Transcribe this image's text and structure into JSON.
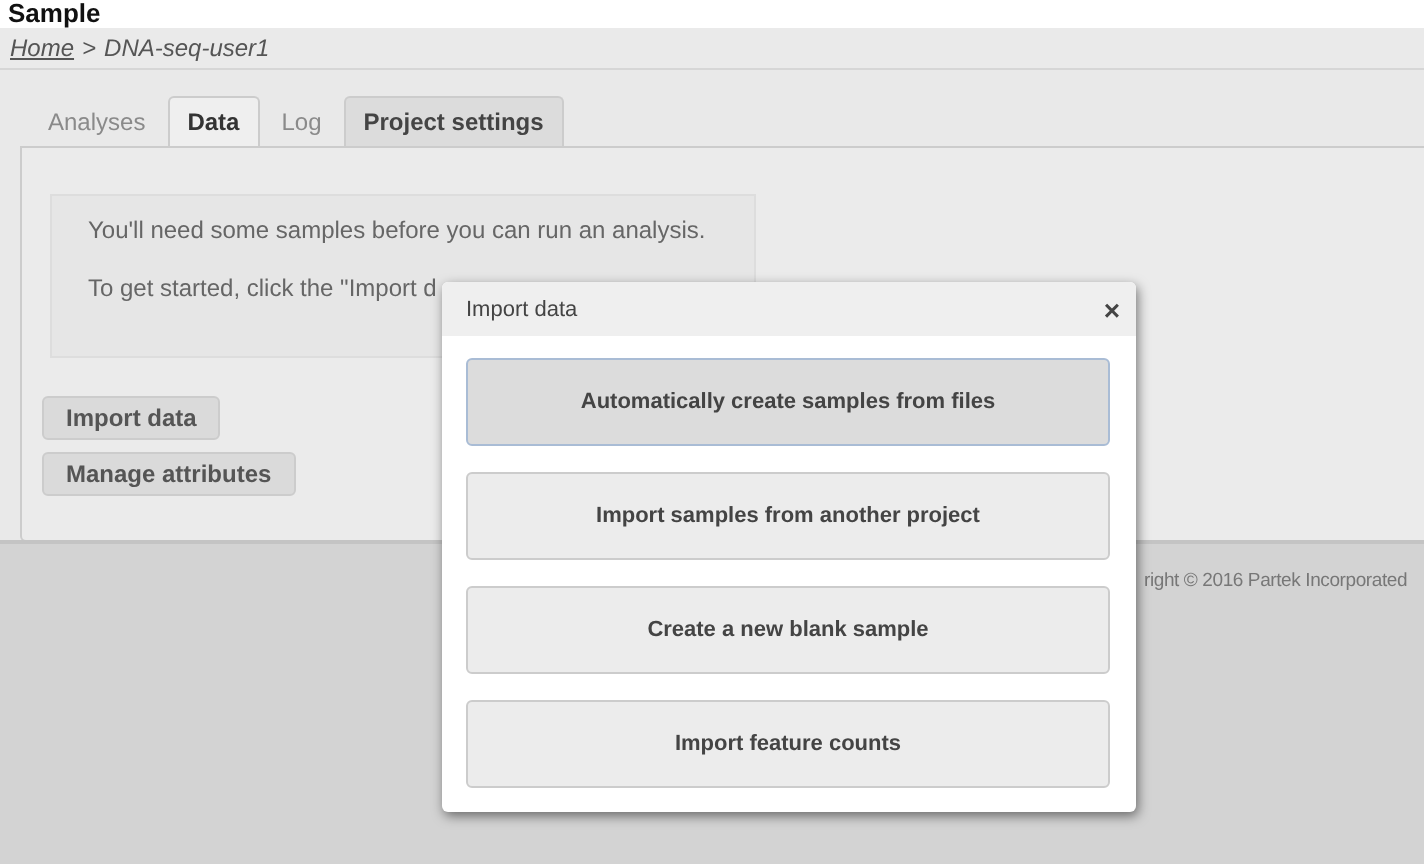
{
  "page_heading": "Sample",
  "breadcrumb": {
    "home": "Home",
    "separator": ">",
    "current": "DNA-seq-user1"
  },
  "tabs": [
    {
      "label": "Analyses",
      "selected": false,
      "disabled": true
    },
    {
      "label": "Data",
      "selected": true,
      "disabled": false
    },
    {
      "label": "Log",
      "selected": false,
      "disabled": true
    },
    {
      "label": "Project settings",
      "selected": false,
      "disabled": false
    }
  ],
  "message": [
    "You'll need some samples before you can run an analysis.",
    "To get started, click the \"Import d"
  ],
  "buttons": [
    "Import data",
    "Manage attributes"
  ],
  "footer": "right © 2016 Partek Incorporated",
  "dialog": {
    "title": "Import data",
    "close": "×",
    "options": [
      {
        "label": "Automatically create samples from files",
        "selected": true
      },
      {
        "label": "Import samples from another project",
        "selected": false
      },
      {
        "label": "Create a new blank sample",
        "selected": false
      },
      {
        "label": "Import feature counts",
        "selected": false
      }
    ]
  }
}
